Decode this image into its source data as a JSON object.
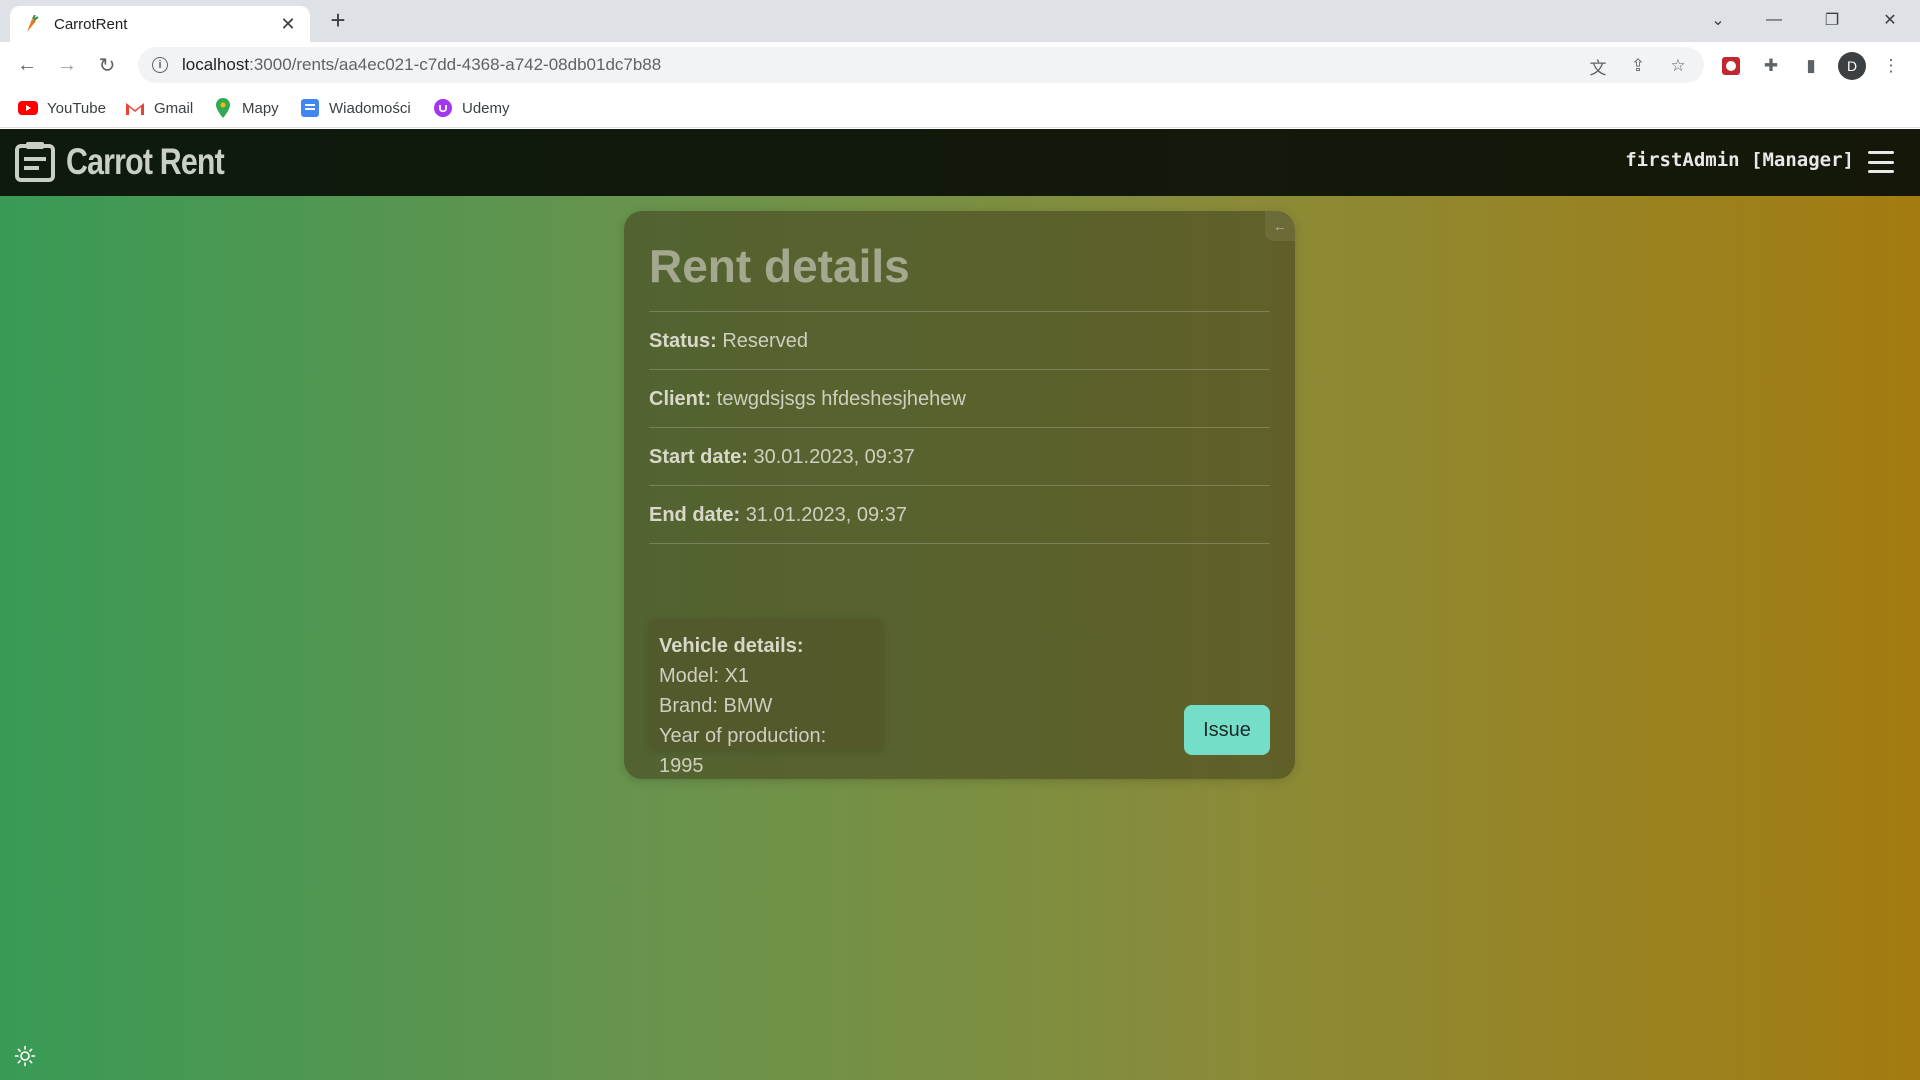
{
  "browser": {
    "tab_title": "CarrotRent",
    "url_host": "localhost",
    "url_path": ":3000/rents/aa4ec021-c7dd-4368-a742-08db01dc7b88",
    "profile_initial": "D",
    "bookmarks": [
      {
        "label": "YouTube",
        "icon": "youtube-icon"
      },
      {
        "label": "Gmail",
        "icon": "gmail-icon"
      },
      {
        "label": "Mapy",
        "icon": "maps-icon"
      },
      {
        "label": "Wiadomości",
        "icon": "news-icon"
      },
      {
        "label": "Udemy",
        "icon": "udemy-icon"
      }
    ]
  },
  "navbar": {
    "brand": "Carrot Rent",
    "user": "firstAdmin [Manager]"
  },
  "rent": {
    "title": "Rent details",
    "status_label": "Status:",
    "status_value": "Reserved",
    "client_label": "Client:",
    "client_value": "tewgdsjsgs hfdeshesjhehew",
    "start_label": "Start date:",
    "start_value": "30.01.2023, 09:37",
    "end_label": "End date:",
    "end_value": "31.01.2023, 09:37",
    "vehicle": {
      "heading": "Vehicle details:",
      "model": "Model: X1",
      "brand": "Brand: BMW",
      "year": "Year of production: 1995"
    },
    "issue_button": "Issue"
  },
  "colors": {
    "accent_button": "#74dec8",
    "gradient_left": "#389a56",
    "gradient_right": "#a47b10"
  }
}
